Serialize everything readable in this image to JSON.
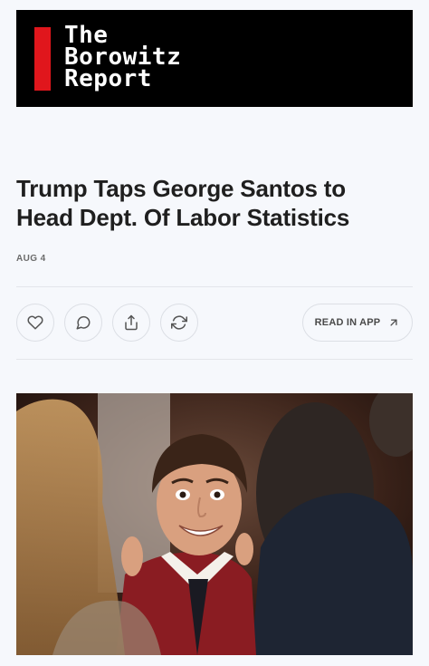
{
  "masthead": {
    "logo_line1": "The",
    "logo_line2": "Borowitz",
    "logo_line3": "Report",
    "accent_color": "#e0161c"
  },
  "article": {
    "title": "Trump Taps George Santos to Head Dept. Of Labor Statistics",
    "date": "AUG 4"
  },
  "actions": {
    "like_icon": "heart-icon",
    "comment_icon": "comment-icon",
    "share_icon": "share-icon",
    "restack_icon": "restack-icon",
    "read_in_app_label": "READ IN APP",
    "read_in_app_icon": "arrow-up-right-icon"
  },
  "hero_image": {
    "subject": "photo"
  }
}
